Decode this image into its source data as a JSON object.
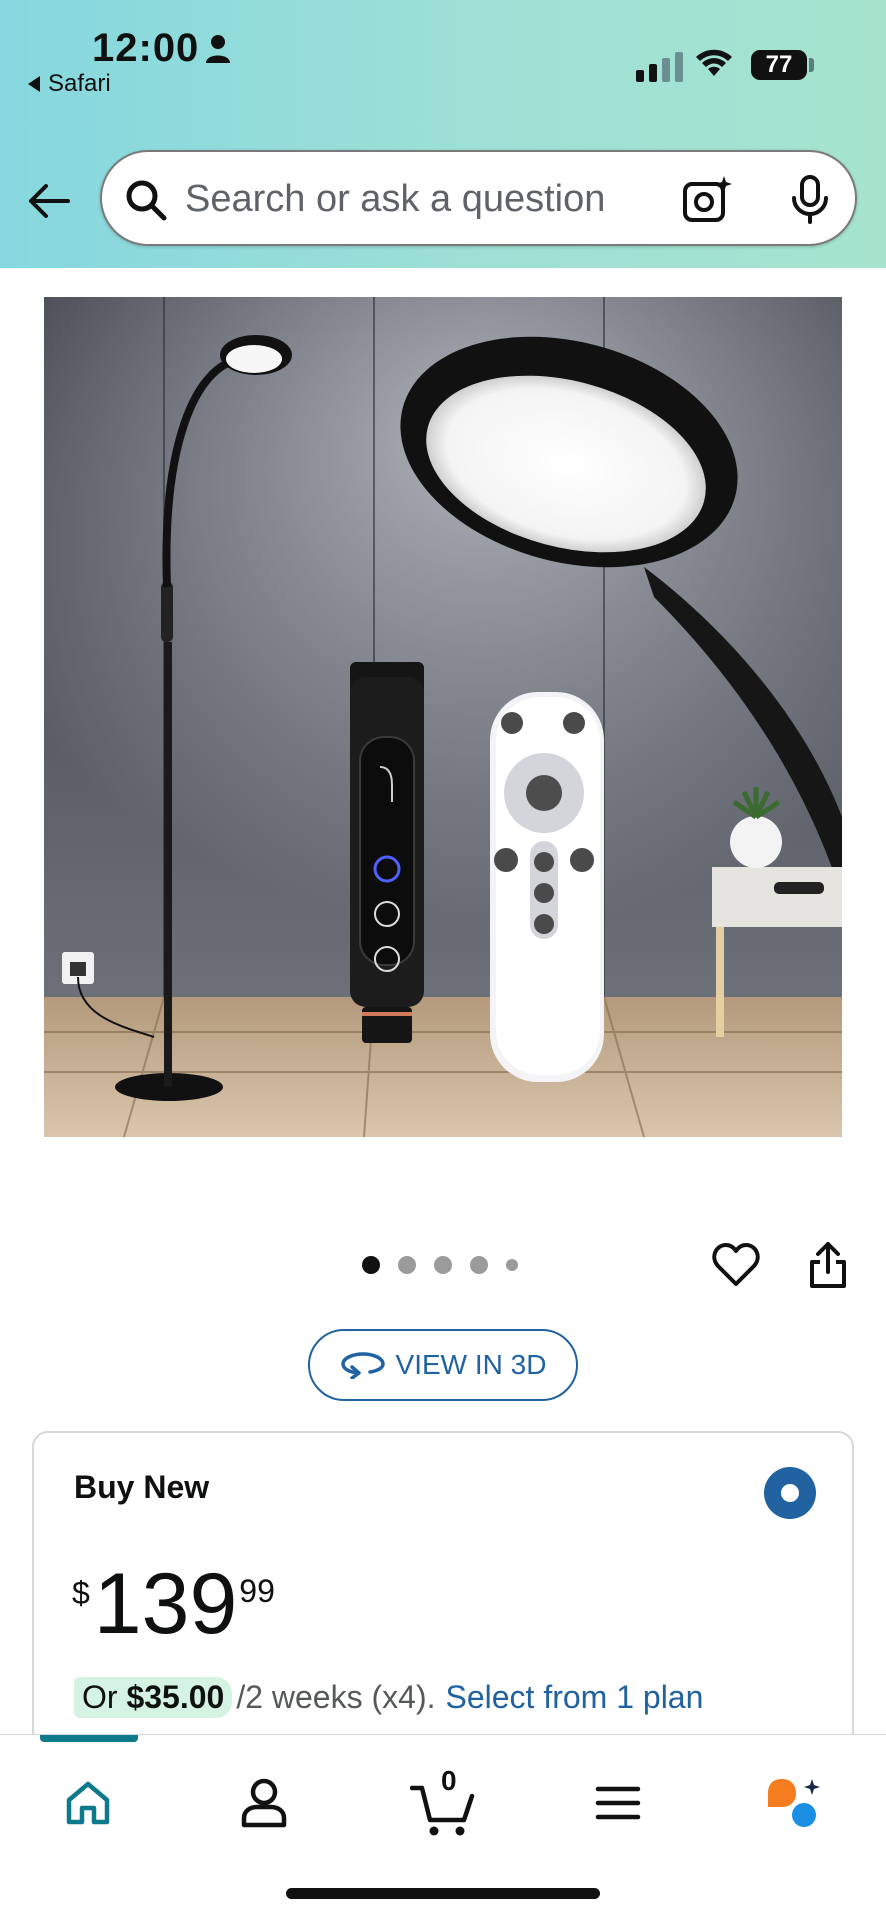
{
  "status_bar": {
    "time": "12:00",
    "back_app": "Safari",
    "battery": "77"
  },
  "search": {
    "placeholder": "Search or ask a question"
  },
  "gallery": {
    "image_count": 5,
    "active_index": 0
  },
  "view_3d": {
    "label": "VIEW IN 3D"
  },
  "buy_box": {
    "title": "Buy New",
    "price_symbol": "$",
    "price_whole": "139",
    "price_fraction": "99",
    "installment_prefix": "Or ",
    "installment_amount": "$35.00",
    "installment_period": "/2 weeks (x4).",
    "installment_link": "Select from 1 plan"
  },
  "bottom_nav": {
    "cart_count": "0",
    "items": [
      "home-icon",
      "account-icon",
      "cart-icon",
      "menu-icon",
      "rufus-icon"
    ]
  },
  "colors": {
    "header_gradient_start": "#86d7df",
    "header_gradient_end": "#a6e4cd",
    "link_blue": "#2162a1",
    "nav_active": "#0c7a8c",
    "installment_highlight": "#d4f3e2"
  }
}
